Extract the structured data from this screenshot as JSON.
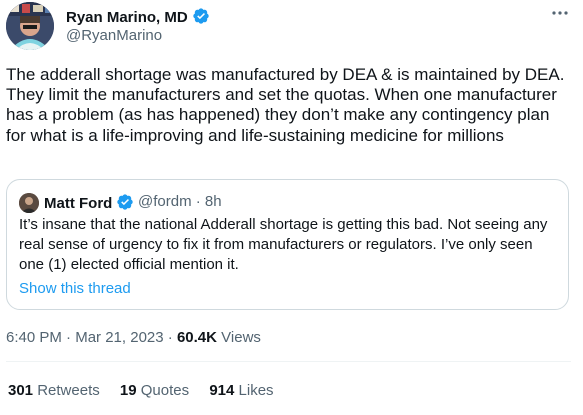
{
  "author": {
    "name": "Ryan Marino, MD",
    "handle": "@RyanMarino"
  },
  "tweet": {
    "text": "The adderall shortage was manufactured by DEA & is maintained by DEA. They limit the manufacturers and set the quotas. When one manufacturer has a problem (as has happened) they don’t make any contingency plan for what is a life-improving and life-sustaining medicine for millions"
  },
  "quote": {
    "name": "Matt Ford",
    "handle": "@fordm",
    "separator": "·",
    "time": "8h",
    "text": "It’s insane that the national Adderall shortage is getting this bad. Not seeing any real sense of urgency to fix it from manufacturers or regulators. I’ve only seen one (1) elected official mention it.",
    "show_thread": "Show this thread"
  },
  "meta": {
    "time": "6:40 PM",
    "separator": "·",
    "date": "Mar 21, 2023",
    "views_count": "60.4K",
    "views_label": "Views"
  },
  "stats": {
    "retweets_count": "301",
    "retweets_label": "Retweets",
    "quotes_count": "19",
    "quotes_label": "Quotes",
    "likes_count": "914",
    "likes_label": "Likes"
  },
  "icons": {
    "verified": "verified-badge-icon",
    "more": "more-icon"
  },
  "colors": {
    "accent": "#1d9bf0",
    "text": "#0f1419",
    "secondary": "#536471",
    "border": "#cfd9de"
  }
}
